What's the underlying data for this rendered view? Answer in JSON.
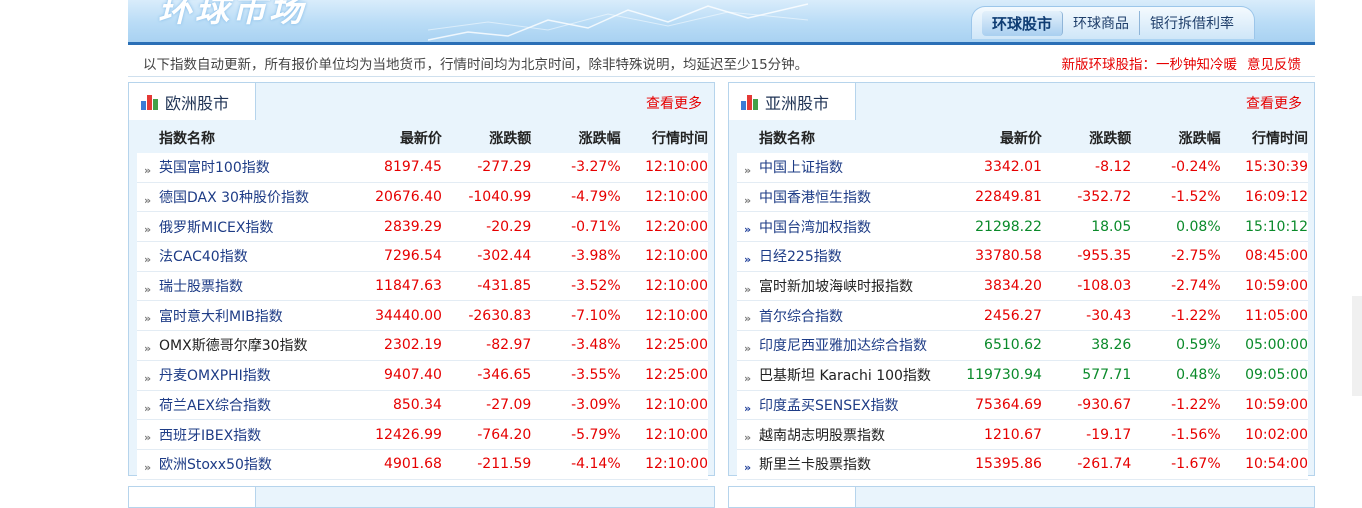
{
  "banner": {
    "title": "环球市场",
    "tabs": [
      {
        "label": "环球股市",
        "active": true
      },
      {
        "label": "环球商品",
        "active": false
      },
      {
        "label": "银行拆借利率",
        "active": false
      }
    ]
  },
  "notice": {
    "text": "以下指数自动更新，所有报价单位均为当地货币，行情时间均为北京时间，除非特殊说明，均延迟至少15分钟。",
    "link1": "新版环球股指：一秒钟知冷暖",
    "link2": "意见反馈"
  },
  "colors": {
    "down": "#e60000",
    "up": "#0a8a2a",
    "link": "#1e3c86",
    "accent": "#2a6fb6"
  },
  "columns": {
    "name": "指数名称",
    "price": "最新价",
    "chg": "涨跌额",
    "pct": "涨跌幅",
    "time": "行情时间"
  },
  "europe": {
    "title": "欧洲股市",
    "more": "查看更多",
    "rows": [
      {
        "name": "英国富时100指数",
        "price": "8197.45",
        "chg": "-277.29",
        "pct": "-3.27%",
        "time": "12:10:00"
      },
      {
        "name": "德国DAX 30种股价指数",
        "price": "20676.40",
        "chg": "-1040.99",
        "pct": "-4.79%",
        "time": "12:10:00"
      },
      {
        "name": "俄罗斯MICEX指数",
        "price": "2839.29",
        "chg": "-20.29",
        "pct": "-0.71%",
        "time": "12:20:00"
      },
      {
        "name": "法CAC40指数",
        "price": "7296.54",
        "chg": "-302.44",
        "pct": "-3.98%",
        "time": "12:10:00"
      },
      {
        "name": "瑞士股票指数",
        "price": "11847.63",
        "chg": "-431.85",
        "pct": "-3.52%",
        "time": "12:10:00"
      },
      {
        "name": "富时意大利MIB指数",
        "price": "34440.00",
        "chg": "-2630.83",
        "pct": "-7.10%",
        "time": "12:10:00"
      },
      {
        "name": "OMX斯德哥尔摩30指数",
        "price": "2302.19",
        "chg": "-82.97",
        "pct": "-3.48%",
        "time": "12:25:00"
      },
      {
        "name": "丹麦OMXPHI指数",
        "price": "9407.40",
        "chg": "-346.65",
        "pct": "-3.55%",
        "time": "12:25:00"
      },
      {
        "name": "荷兰AEX综合指数",
        "price": "850.34",
        "chg": "-27.09",
        "pct": "-3.09%",
        "time": "12:10:00"
      },
      {
        "name": "西班牙IBEX指数",
        "price": "12426.99",
        "chg": "-764.20",
        "pct": "-5.79%",
        "time": "12:10:00"
      },
      {
        "name": "欧洲Stoxx50指数",
        "price": "4901.68",
        "chg": "-211.59",
        "pct": "-4.14%",
        "time": "12:10:00"
      }
    ]
  },
  "asia": {
    "title": "亚洲股市",
    "more": "查看更多",
    "rows": [
      {
        "name": "中国上证指数",
        "price": "3342.01",
        "chg": "-8.12",
        "pct": "-0.24%",
        "time": "15:30:39"
      },
      {
        "name": "中国香港恒生指数",
        "price": "22849.81",
        "chg": "-352.72",
        "pct": "-1.52%",
        "time": "16:09:12"
      },
      {
        "name": "中国台湾加权指数",
        "price": "21298.22",
        "chg": "18.05",
        "pct": "0.08%",
        "time": "15:10:12"
      },
      {
        "name": "日经225指数",
        "price": "33780.58",
        "chg": "-955.35",
        "pct": "-2.75%",
        "time": "08:45:00"
      },
      {
        "name": "富时新加坡海峡时报指数",
        "price": "3834.20",
        "chg": "-108.03",
        "pct": "-2.74%",
        "time": "10:59:00"
      },
      {
        "name": "首尔综合指数",
        "price": "2456.27",
        "chg": "-30.43",
        "pct": "-1.22%",
        "time": "11:05:00"
      },
      {
        "name": "印度尼西亚雅加达综合指数",
        "price": "6510.62",
        "chg": "38.26",
        "pct": "0.59%",
        "time": "05:00:00"
      },
      {
        "name": "巴基斯坦 Karachi 100指数",
        "price": "119730.94",
        "chg": "577.71",
        "pct": "0.48%",
        "time": "09:05:00"
      },
      {
        "name": "印度孟买SENSEX指数",
        "price": "75364.69",
        "chg": "-930.67",
        "pct": "-1.22%",
        "time": "10:59:00"
      },
      {
        "name": "越南胡志明股票指数",
        "price": "1210.67",
        "chg": "-19.17",
        "pct": "-1.56%",
        "time": "10:02:00"
      },
      {
        "name": "斯里兰卡股票指数",
        "price": "15395.86",
        "chg": "-261.74",
        "pct": "-1.67%",
        "time": "10:54:00"
      }
    ]
  }
}
